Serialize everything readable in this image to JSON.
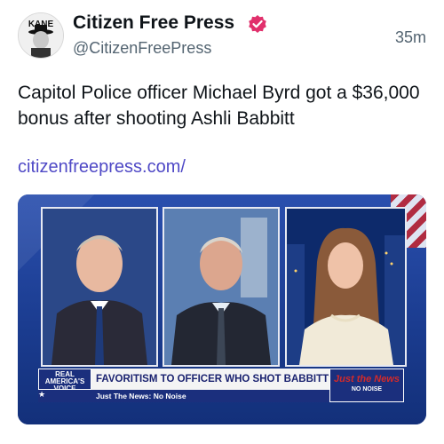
{
  "account": {
    "display_name": "Citizen Free Press",
    "handle": "@CitizenFreePress",
    "avatar_text": "KANE",
    "verified_badge_color": "#e1306c"
  },
  "post": {
    "timestamp": "35m",
    "text": "Capitol Police officer Michael Byrd got a $36,000 bonus after shooting Ashli Babbitt",
    "link": "citizenfreepress.com/"
  },
  "media": {
    "logo_text": "REAL AMERICA'S VOICE",
    "headline": "FAVORITISM TO OFFICER WHO SHOT BABBITT?",
    "subline": "Just The News: No Noise",
    "brand_top": "Just the News",
    "brand_bottom": "NO NOISE"
  },
  "colors": {
    "link": "#4f49c6",
    "secondary_text": "#536471",
    "media_blue": "#1b2f7d"
  }
}
